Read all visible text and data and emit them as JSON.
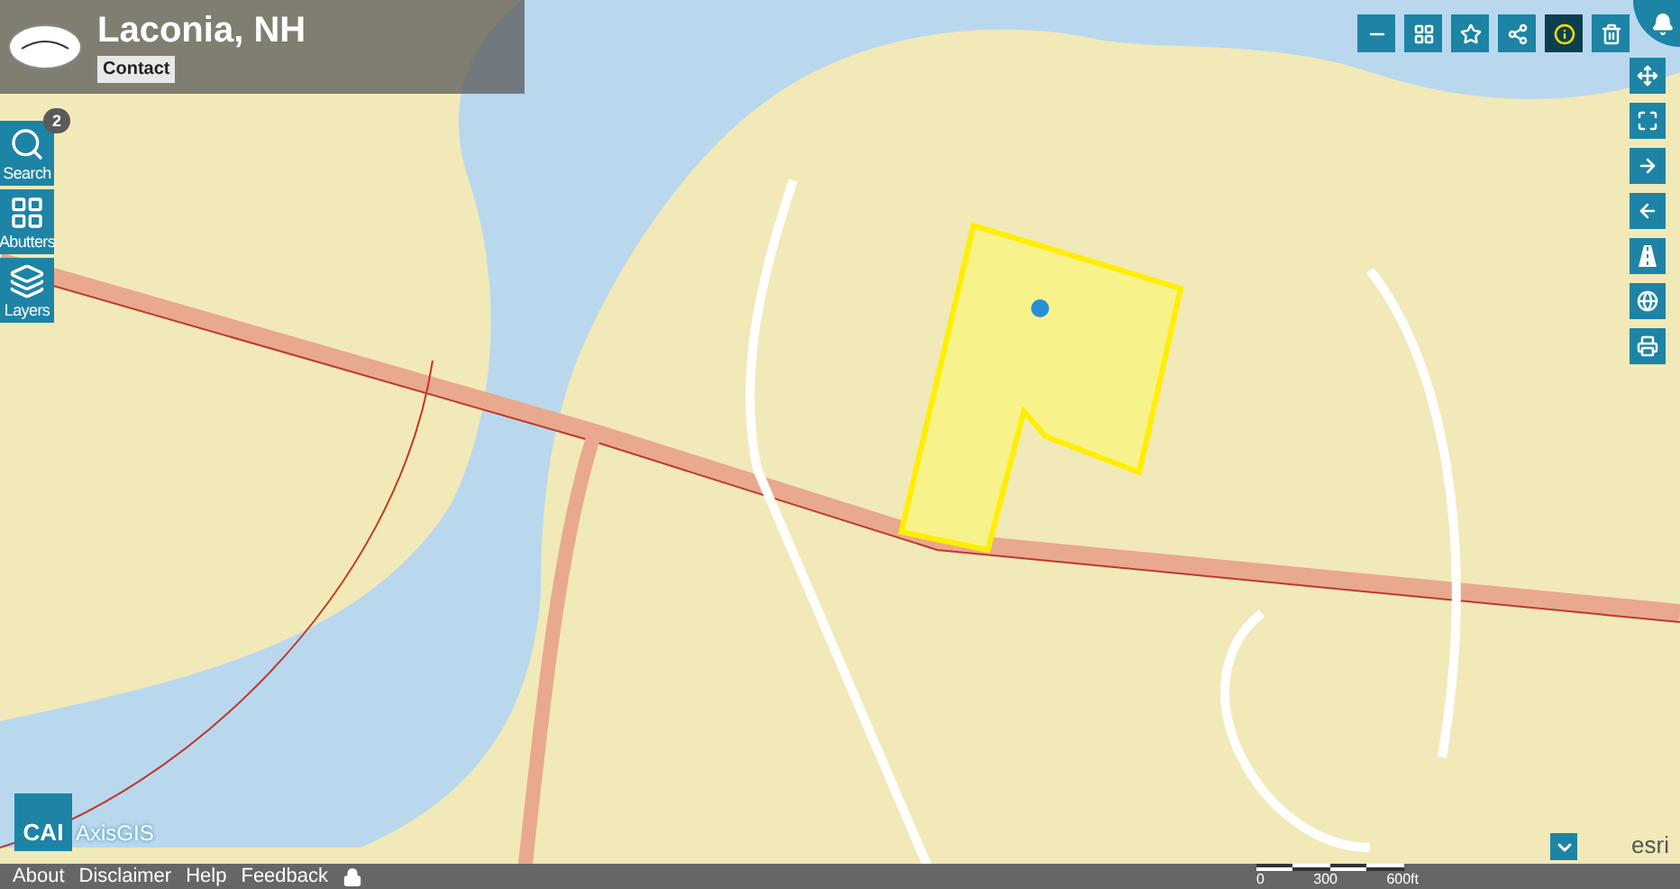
{
  "header": {
    "title": "Laconia, NH",
    "contact": "Contact"
  },
  "left_tools": [
    {
      "kind": "search",
      "label": "Search",
      "badge": "2"
    },
    {
      "kind": "abutters",
      "label": "Abutters"
    },
    {
      "kind": "layers",
      "label": "Layers"
    }
  ],
  "top_tools": [
    {
      "kind": "measure",
      "selected": false
    },
    {
      "kind": "grid",
      "selected": false
    },
    {
      "kind": "star",
      "selected": false
    },
    {
      "kind": "share",
      "selected": false
    },
    {
      "kind": "info",
      "selected": true
    },
    {
      "kind": "trash",
      "selected": false
    }
  ],
  "side_tools": [
    {
      "kind": "pan"
    },
    {
      "kind": "extent"
    },
    {
      "kind": "next"
    },
    {
      "kind": "previous"
    },
    {
      "kind": "road"
    },
    {
      "kind": "globe"
    },
    {
      "kind": "print"
    }
  ],
  "logo": {
    "brand": "CAI",
    "product": "AxisGIS"
  },
  "footer": {
    "links": [
      "About",
      "Disclaimer",
      "Help",
      "Feedback"
    ]
  },
  "scale": {
    "labels": [
      "0",
      "300",
      "600ft"
    ]
  },
  "attribution": "esri"
}
